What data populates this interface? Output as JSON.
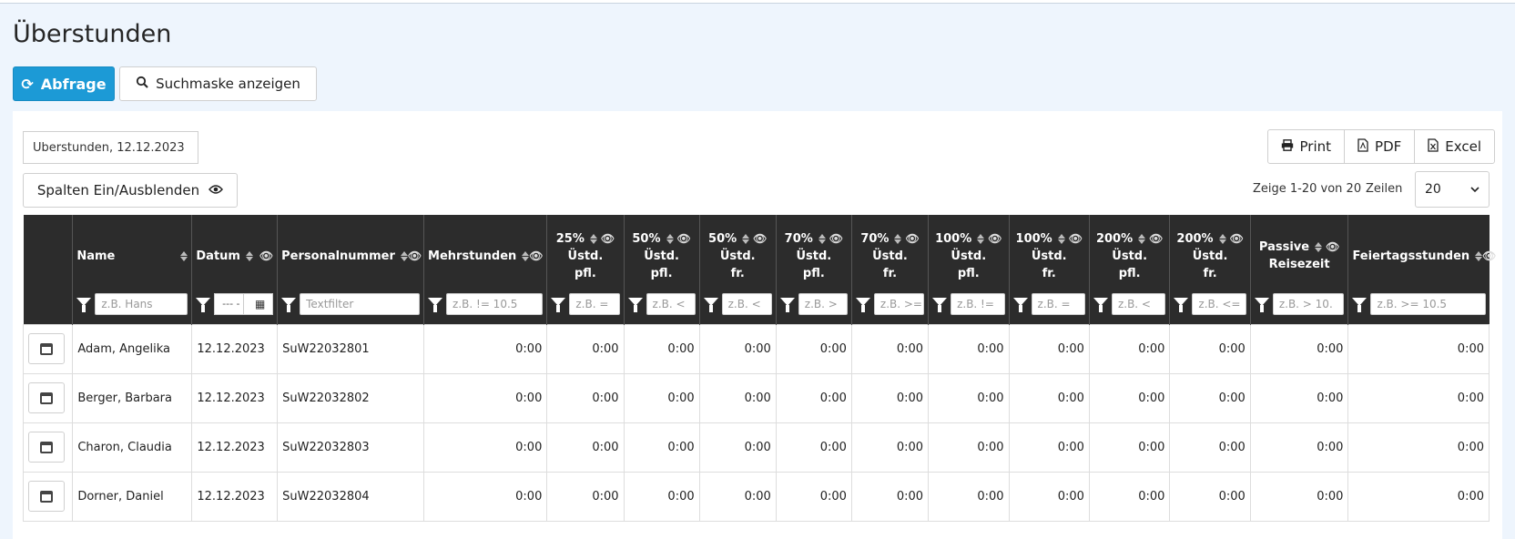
{
  "page": {
    "title": "Überstunden"
  },
  "toolbar": {
    "query_label": "Abfrage",
    "search_mask_label": "Suchmaske anzeigen"
  },
  "report": {
    "name": "Überstunden, 12.12.2023"
  },
  "export": {
    "print_label": "Print",
    "pdf_label": "PDF",
    "excel_label": "Excel"
  },
  "columns_toggle": {
    "label": "Spalten Ein/Ausblenden"
  },
  "paging": {
    "info": "Zeige 1-20 von 20",
    "rows_label": "Zeilen",
    "rows_value": "20"
  },
  "table": {
    "headers": {
      "name": "Name",
      "datum": "Datum",
      "personalnummer": "Personalnummer",
      "mehrstunden": "Mehrstunden",
      "c25_l1": "25%",
      "c25_l2": "Üstd.",
      "c25_l3": "pfl.",
      "c50p_l1": "50%",
      "c50p_l2": "Üstd.",
      "c50p_l3": "pfl.",
      "c50f_l1": "50%",
      "c50f_l2": "Üstd.",
      "c50f_l3": "fr.",
      "c70p_l1": "70%",
      "c70p_l2": "Üstd.",
      "c70p_l3": "pfl.",
      "c70f_l1": "70%",
      "c70f_l2": "Üstd.",
      "c70f_l3": "fr.",
      "c100p_l1": "100%",
      "c100p_l2": "Üstd.",
      "c100p_l3": "pfl.",
      "c100f_l1": "100%",
      "c100f_l2": "Üstd.",
      "c100f_l3": "fr.",
      "c200p_l1": "200%",
      "c200p_l2": "Üstd.",
      "c200p_l3": "pfl.",
      "c200f_l1": "200%",
      "c200f_l2": "Üstd.",
      "c200f_l3": "fr.",
      "passive_l1": "Passive",
      "passive_l2": "Reisezeit",
      "feiertag": "Feiertagsstunden"
    },
    "filters": {
      "name": "z.B. Hans",
      "datum": "--- -",
      "personalnummer": "Textfilter",
      "mehrstunden": "z.B. != 10.5",
      "c25": "z.B. =",
      "c50p": "z.B. <",
      "c50f": "z.B. <",
      "c70p": "z.B. >",
      "c70f": "z.B. >=",
      "c100p": "z.B. !=",
      "c100f": "z.B. =",
      "c200p": "z.B. <",
      "c200f": "z.B. <=",
      "passive": "z.B. > 10.",
      "feiertag": "z.B. >= 10.5"
    },
    "rows": [
      {
        "name": "Adam, Angelika",
        "datum": "12.12.2023",
        "pnr": "SuW22032801",
        "v": [
          "0:00",
          "0:00",
          "0:00",
          "0:00",
          "0:00",
          "0:00",
          "0:00",
          "0:00",
          "0:00",
          "0:00",
          "0:00",
          "0:00"
        ]
      },
      {
        "name": "Berger, Barbara",
        "datum": "12.12.2023",
        "pnr": "SuW22032802",
        "v": [
          "0:00",
          "0:00",
          "0:00",
          "0:00",
          "0:00",
          "0:00",
          "0:00",
          "0:00",
          "0:00",
          "0:00",
          "0:00",
          "0:00"
        ]
      },
      {
        "name": "Charon, Claudia",
        "datum": "12.12.2023",
        "pnr": "SuW22032803",
        "v": [
          "0:00",
          "0:00",
          "0:00",
          "0:00",
          "0:00",
          "0:00",
          "0:00",
          "0:00",
          "0:00",
          "0:00",
          "0:00",
          "0:00"
        ]
      },
      {
        "name": "Dorner, Daniel",
        "datum": "12.12.2023",
        "pnr": "SuW22032804",
        "v": [
          "0:00",
          "0:00",
          "0:00",
          "0:00",
          "0:00",
          "0:00",
          "0:00",
          "0:00",
          "0:00",
          "0:00",
          "0:00",
          "0:00"
        ]
      }
    ]
  }
}
